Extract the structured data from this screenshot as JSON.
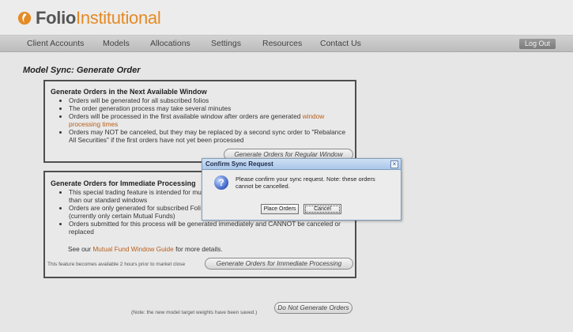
{
  "brand": {
    "name_part1": "Folio",
    "name_part2": "Institutional"
  },
  "nav": {
    "items": [
      "Client Accounts",
      "Models",
      "Allocations",
      "Settings",
      "Resources",
      "Contact Us"
    ],
    "logout": "Log Out"
  },
  "page": {
    "title": "Model Sync: Generate Order"
  },
  "section_regular": {
    "heading": "Generate Orders in the Next Available Window",
    "bullets": [
      "Orders will be generated for all subscribed folios",
      "The order generation process may take several minutes",
      "Orders will be processed in the first available window after orders are generated ",
      "Orders may NOT be canceled, but they may be replaced by a second sync order to \"Rebalance All Securities\" if the first orders have not yet been processed"
    ],
    "bullet3_link": "window processing times",
    "button": "Generate Orders for Regular Window"
  },
  "section_immediate": {
    "heading": "Generate Orders for Immediate Processing",
    "bullet1": "This special trading feature is intended for mu",
    "bullet1b": "than our standard windows",
    "bullet2": "Orders are only generated for subscribed Foli",
    "bullet2b": "(currently only certain Mutual Funds)",
    "bullet3": "Orders submitted for this process will be generated immediately and CANNOT be canceled or",
    "bullet3b": "replaced",
    "see_prefix": "See our ",
    "see_link": "Mutual Fund Window Guide",
    "see_suffix": " for more details.",
    "availability_note": "This feature becomes available 2 hours prior to market close",
    "button": "Generate Orders for Immediate Processing"
  },
  "footer": {
    "note": "(Note: the new model target weights have been saved.)",
    "button": "Do Not Generate Orders"
  },
  "dialog": {
    "title": "Confirm Sync Request",
    "close": "×",
    "icon": "question-icon",
    "message": "Please confirm your sync request. Note: these orders cannot be cancelled.",
    "ok": "Place Orders",
    "cancel": "Cancel"
  },
  "colors": {
    "brand_orange": "#e58a24",
    "link": "#b85e1a",
    "dialog_title_bg": "#a9c6ea"
  }
}
